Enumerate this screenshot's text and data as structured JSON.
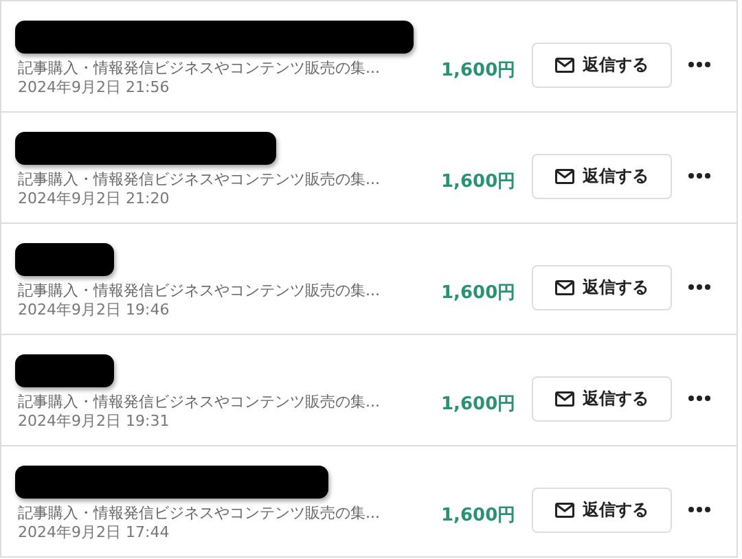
{
  "messages": [
    {
      "sender": {
        "kind": "redacted"
      },
      "item": "記事購入・情報発信ビジネスやコンテンツ販売の集...",
      "date": "2024年9月2日 21:56",
      "price": "1,600円",
      "reply_button": "返信する"
    },
    {
      "sender": {
        "kind": "redacted"
      },
      "item": "記事購入・情報発信ビジネスやコンテンツ販売の集...",
      "date": "2024年9月2日 21:20",
      "price": "1,600円",
      "reply_button": "返信する"
    },
    {
      "sender": {
        "kind": "redacted"
      },
      "item": "記事購入・情報発信ビジネスやコンテンツ販売の集...",
      "date": "2024年9月2日 19:46",
      "price": "1,600円",
      "reply_button": "返信する"
    },
    {
      "sender": {
        "kind": "redacted"
      },
      "item": "記事購入・情報発信ビジネスやコンテンツ販売の集...",
      "date": "2024年9月2日 19:31",
      "price": "1,600円",
      "reply_button": "返信する"
    },
    {
      "sender": {
        "kind": "redacted"
      },
      "item": "記事購入・情報発信ビジネスやコンテンツ販売の集...",
      "date": "2024年9月2日 17:44",
      "price": "1,600円",
      "reply_button": "返信する"
    }
  ]
}
